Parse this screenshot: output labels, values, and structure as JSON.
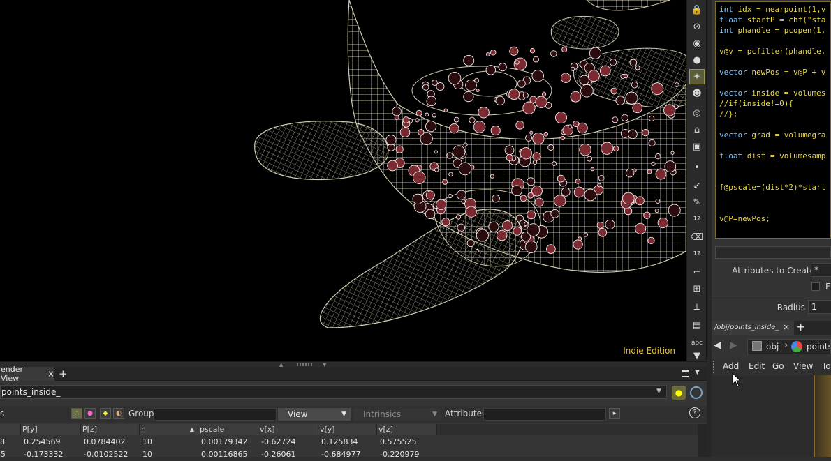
{
  "viewport": {
    "edition_label": "Indie Edition"
  },
  "viewport_tools": [
    {
      "icon": "lock-icon"
    },
    {
      "icon": "pin-icon"
    },
    {
      "icon": "light-icon"
    },
    {
      "icon": "bulb-icon"
    },
    {
      "icon": "camera-light-icon"
    },
    {
      "icon": "head-light-icon"
    },
    {
      "icon": "display-options-icon"
    },
    {
      "icon": "ghost-icon"
    },
    {
      "icon": "snapshot-icon"
    },
    {
      "icon": "point-icon"
    },
    {
      "icon": "normal-icon"
    },
    {
      "icon": "pen-icon"
    },
    {
      "icon": "number-12-icon"
    },
    {
      "icon": "paint-icon"
    },
    {
      "icon": "number-12b-icon"
    },
    {
      "icon": "corner-icon"
    },
    {
      "icon": "grid-select-icon"
    },
    {
      "icon": "axis-icon"
    },
    {
      "icon": "frame-icon"
    },
    {
      "icon": "text-abc-icon",
      "label": "abc"
    },
    {
      "icon": "arrow-down-icon"
    }
  ],
  "bottom_pane": {
    "tabs": [
      {
        "label": "ender View",
        "close": "×"
      },
      {
        "label": "+"
      }
    ],
    "path": "points_inside_",
    "toolbar": {
      "left_fragment": "s",
      "group_label": "Group:",
      "view_button": "View",
      "intrinsics_button": "Intrinsics",
      "attributes_label": "Attributes:",
      "help": "?"
    },
    "table": {
      "columns": [
        "P[y]",
        "P[z]",
        "n",
        "pscale",
        "v[x]",
        "v[y]",
        "v[z]"
      ],
      "sort_indicator": "▲",
      "first_col_fragment": [
        "8",
        "85"
      ],
      "rows": [
        [
          "0.254569",
          "0.0784402",
          "10",
          "0.00179342",
          "-0.62724",
          "0.125834",
          "0.575525"
        ],
        [
          "-0.173332",
          "-0.0102522",
          "10",
          "0.00116865",
          "-0.26061",
          "-0.684977",
          "-0.220979"
        ]
      ]
    }
  },
  "right_pane": {
    "code_lines": [
      {
        "type": "int",
        "rest": " idx = nearpoint(1,v"
      },
      {
        "type": "float",
        "rest": " startP = chf(\"sta"
      },
      {
        "type": "int",
        "rest": " phandle = pcopen(1,"
      },
      {
        "type": "",
        "rest": ""
      },
      {
        "type": "",
        "rest": "v@v = pcfilter(phandle,"
      },
      {
        "type": "",
        "rest": ""
      },
      {
        "type": "vector",
        "rest": " newPos = v@P + v"
      },
      {
        "type": "",
        "rest": ""
      },
      {
        "type": "vector",
        "rest": " inside = volumes"
      },
      {
        "type": "",
        "rest": "//if(inside!=0){"
      },
      {
        "type": "",
        "rest": "//};"
      },
      {
        "type": "",
        "rest": ""
      },
      {
        "type": "vector",
        "rest": " grad = volumegra"
      },
      {
        "type": "",
        "rest": ""
      },
      {
        "type": "float",
        "rest": " dist = volumesamp"
      },
      {
        "type": "",
        "rest": ""
      },
      {
        "type": "",
        "rest": ""
      },
      {
        "type": "",
        "rest": "f@pscale=(dist*2)*start"
      },
      {
        "type": "",
        "rest": ""
      },
      {
        "type": "",
        "rest": ""
      },
      {
        "type": "",
        "rest": "v@P=newPos;"
      }
    ],
    "attributes_to_create_label": "Attributes to Create",
    "attributes_to_create_value": "*",
    "enforce_fragment": "Er",
    "radius_label": "Radius",
    "radius_value": "1",
    "network_tab": "/obj/points_inside_",
    "network_tab_close": "×",
    "network_tab_add": "+",
    "nav_obj": "obj",
    "nav_node": "points_",
    "menu": [
      "Add",
      "Edit",
      "Go",
      "View",
      "To"
    ]
  }
}
